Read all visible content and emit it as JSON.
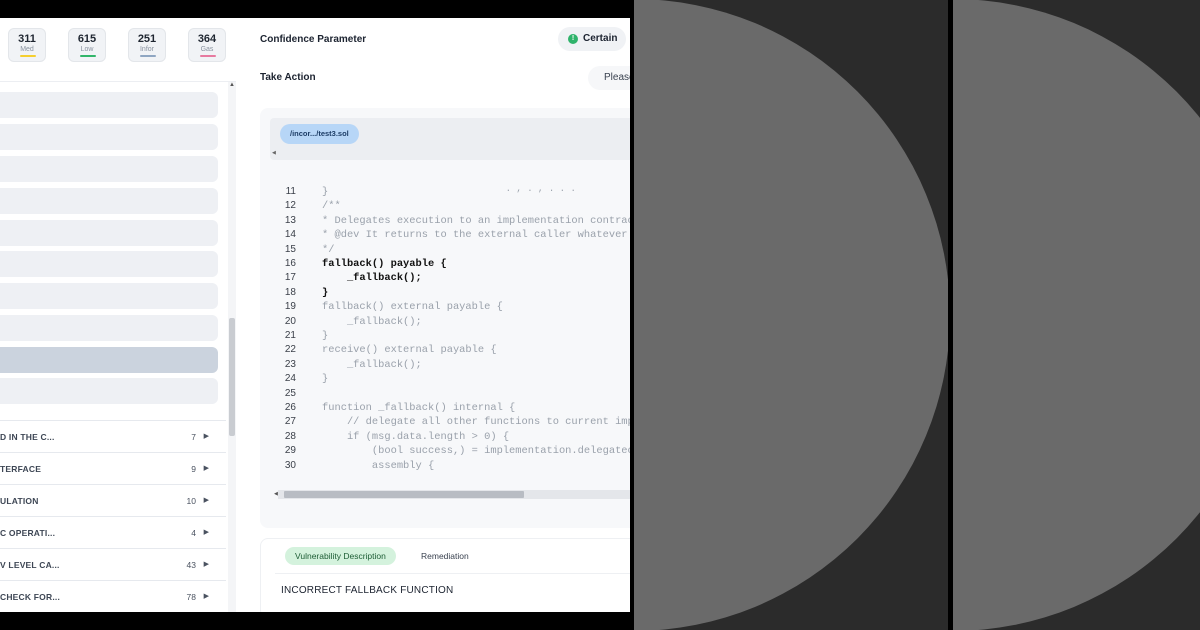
{
  "stats": [
    {
      "value": "311",
      "label": "Med",
      "color": "#f5cf2f"
    },
    {
      "value": "615",
      "label": "Low",
      "color": "#32b56a"
    },
    {
      "value": "251",
      "label": "Infor",
      "color": "#8fa6c2"
    },
    {
      "value": "364",
      "label": "Gas",
      "color": "#e77aa0"
    }
  ],
  "vulnerabilities": [
    {
      "title": "D IN THE C...",
      "count": "7"
    },
    {
      "title": "TERFACE",
      "count": "9"
    },
    {
      "title": "ULATION",
      "count": "10"
    },
    {
      "title": "C OPERATI...",
      "count": "4"
    },
    {
      "title": "V LEVEL CA...",
      "count": "43"
    },
    {
      "title": "CHECK FOR...",
      "count": "78"
    }
  ],
  "header": {
    "confidence_label": "Confidence Parameter",
    "confidence_value": "Certain",
    "confidence_icon": "!",
    "action_label": "Take Action",
    "action_value": "Please"
  },
  "file": {
    "path": "/incor.../test3.sol"
  },
  "code": {
    "partial_top": "                                  . , . , . . .",
    "lines": [
      {
        "n": "11",
        "text": "}",
        "hl": false
      },
      {
        "n": "12",
        "text": "/**",
        "hl": false
      },
      {
        "n": "13",
        "text": "* Delegates execution to an implementation contrac",
        "hl": false
      },
      {
        "n": "14",
        "text": "* @dev It returns to the external caller whatever",
        "hl": false
      },
      {
        "n": "15",
        "text": "*/",
        "hl": false
      },
      {
        "n": "16",
        "text": "fallback() payable {",
        "hl": true
      },
      {
        "n": "17",
        "text": "    _fallback();",
        "hl": true
      },
      {
        "n": "18",
        "text": "}",
        "hl": true
      },
      {
        "n": "19",
        "text": "fallback() external payable {",
        "hl": false
      },
      {
        "n": "20",
        "text": "    _fallback();",
        "hl": false
      },
      {
        "n": "21",
        "text": "}",
        "hl": false
      },
      {
        "n": "22",
        "text": "receive() external payable {",
        "hl": false
      },
      {
        "n": "23",
        "text": "    _fallback();",
        "hl": false
      },
      {
        "n": "24",
        "text": "}",
        "hl": false
      },
      {
        "n": "25",
        "text": "",
        "hl": false
      },
      {
        "n": "26",
        "text": "function _fallback() internal {",
        "hl": false
      },
      {
        "n": "27",
        "text": "    // delegate all other functions to current imp",
        "hl": false
      },
      {
        "n": "28",
        "text": "    if (msg.data.length > 0) {",
        "hl": false
      },
      {
        "n": "29",
        "text": "        (bool success,) = implementation.delegatec",
        "hl": false
      },
      {
        "n": "30",
        "text": "        assembly {",
        "hl": false
      }
    ]
  },
  "tabs": {
    "description": "Vulnerability Description",
    "remediation": "Remediation"
  },
  "vulnerability_title": "INCORRECT FALLBACK FUNCTION"
}
